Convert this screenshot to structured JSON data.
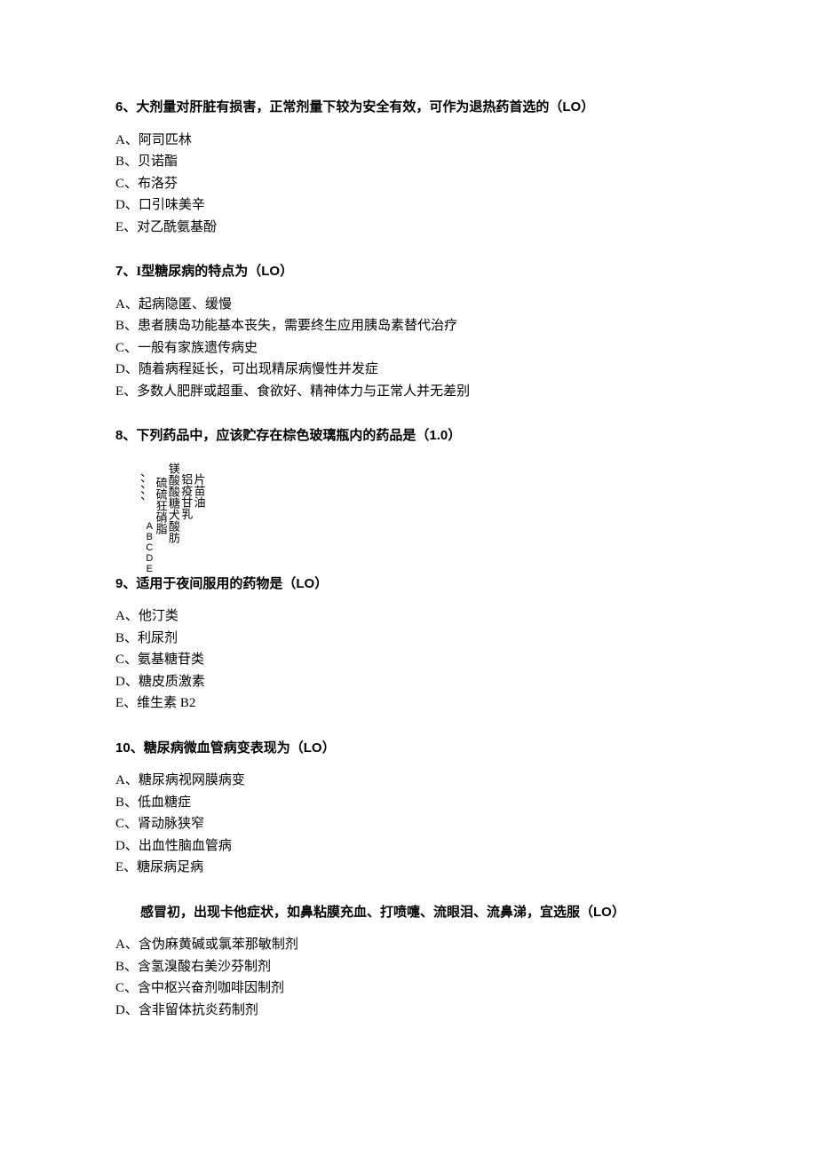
{
  "q6": {
    "number": "6",
    "sep": "、",
    "text": "大剂量对肝脏有损害，正常剂量下较为安全有效，可作为退热药首选的（",
    "score": "LO",
    "close": "）",
    "opts": [
      {
        "l": "A、",
        "t": "阿司匹林"
      },
      {
        "l": "B、",
        "t": "贝诺酯"
      },
      {
        "l": "C、",
        "t": "布洛芬"
      },
      {
        "l": "D、",
        "t": "口引味美辛"
      },
      {
        "l": "E、",
        "t": "对乙酰氨基酚"
      }
    ]
  },
  "q7": {
    "number": "7",
    "sep": "、",
    "bold1": "I",
    "text1": "型糖尿病的特点为（",
    "score": "LO",
    "close": "）",
    "opts": [
      {
        "l": "A、",
        "t": "起病隐匿、缓慢"
      },
      {
        "l": "B、",
        "t": "患者胰岛功能基本丧失，需要终生应用胰岛素替代治疗"
      },
      {
        "l": "C、",
        "t": "一般有家族遗传病史"
      },
      {
        "l": "D、",
        "t": "随着病程延长，可出现精尿病慢性并发症"
      },
      {
        "l": "E、",
        "t": "多数人肥胖或超重、食欲好、精神体力与正常人并无差别"
      }
    ]
  },
  "q8": {
    "number": "8",
    "sep": "、",
    "text": "下列药品中，应该贮存在棕色玻璃瓶内的药品是（",
    "score": "1.0",
    "close": "）",
    "vcol1": "、、、、、",
    "vcol2": "ABCDE",
    "vcol3": "硫硫狂硝脂",
    "vcol4": "镁酸酸糖犬酸肪",
    "vcol5": "铝疫甘乳",
    "vcol6": "片苗油"
  },
  "q9": {
    "number": "9",
    "sep": "、",
    "text": "适用于夜间服用的药物是（",
    "score": "LO",
    "close": "）",
    "opts": [
      {
        "l": "A、",
        "t": "他汀类"
      },
      {
        "l": "B、",
        "t": "利尿剂"
      },
      {
        "l": "C、",
        "t": "氨基糖苷类"
      },
      {
        "l": "D、",
        "t": "糖皮质激素"
      },
      {
        "l": "E、",
        "t": "维生素 B2"
      }
    ]
  },
  "q10": {
    "number": "10",
    "sep": "、",
    "text": "糖尿病微血管病变表现为（",
    "score": "LO",
    "close": "）",
    "opts": [
      {
        "l": "A、",
        "t": "糖尿病视网膜病变"
      },
      {
        "l": "B、",
        "t": "低血糖症"
      },
      {
        "l": "C、",
        "t": "肾动脉狭窄"
      },
      {
        "l": "D、",
        "t": "出血性脑血管病"
      },
      {
        "l": "E、",
        "t": "糖尿病足病"
      }
    ]
  },
  "q11": {
    "text": "感冒初，出现卡他症状，如鼻粘膜充血、打喷嚏、流眼泪、流鼻涕，宜选服（",
    "score": "LO",
    "close": "）",
    "opts": [
      {
        "l": "A、",
        "t": "含伪麻黄碱或氯苯那敏制剂"
      },
      {
        "l": "B、",
        "t": "含氢溴酸右美沙芬制剂"
      },
      {
        "l": "C、",
        "t": "含中枢兴奋剂咖啡因制剂"
      },
      {
        "l": "D、",
        "t": "含非留体抗炎药制剂"
      }
    ]
  }
}
